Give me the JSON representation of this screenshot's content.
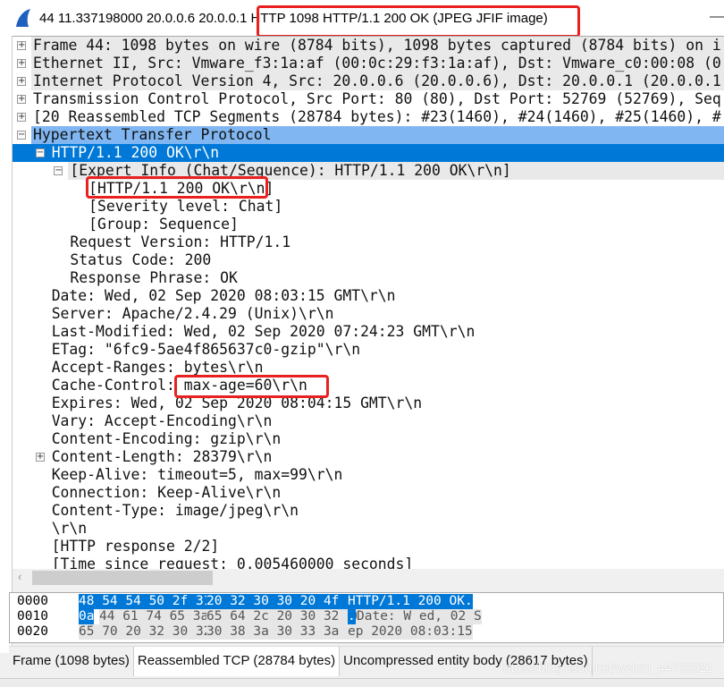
{
  "window": {
    "title_prefix": "44 11.337198000 20.0.0.6 20.0.0.1",
    "title_highlight": "HTTP 1098 HTTP/1.1 200 OK  (JPEG JFIF image)",
    "min_label": "—"
  },
  "tree": [
    {
      "level": 0,
      "exp": "+",
      "text": "Frame 44: 1098 bytes on wire (8784 bits), 1098 bytes captured (8784 bits) on i",
      "style": "g"
    },
    {
      "level": 0,
      "exp": "+",
      "text": "Ethernet II, Src: Vmware_f3:1a:af (00:0c:29:f3:1a:af), Dst: Vmware_c0:00:08 (0",
      "style": "g"
    },
    {
      "level": 0,
      "exp": "+",
      "text": "Internet Protocol Version 4, Src: 20.0.0.6 (20.0.0.6), Dst: 20.0.0.1 (20.0.0.1",
      "style": "g"
    },
    {
      "level": 0,
      "exp": "+",
      "text": "Transmission Control Protocol, Src Port: 80 (80), Dst Port: 52769 (52769), Seq",
      "style": ""
    },
    {
      "level": 0,
      "exp": "+",
      "text": "[20 Reassembled TCP Segments (28784 bytes): #23(1460), #24(1460), #25(1460), #",
      "style": ""
    },
    {
      "level": 0,
      "exp": "−",
      "text": "Hypertext Transfer Protocol",
      "style": "lb"
    },
    {
      "level": 1,
      "exp": "−",
      "text": "HTTP/1.1 200 OK\\r\\n",
      "style": "sel"
    },
    {
      "level": 2,
      "exp": "−",
      "text": "[Expert Info (Chat/Sequence): HTTP/1.1 200 OK\\r\\n]",
      "style": "g"
    },
    {
      "level": 3,
      "exp": "",
      "text": "[HTTP/1.1 200 OK\\r\\n]",
      "style": ""
    },
    {
      "level": 3,
      "exp": "",
      "text": "[Severity level: Chat]",
      "style": ""
    },
    {
      "level": 3,
      "exp": "",
      "text": "[Group: Sequence]",
      "style": ""
    },
    {
      "level": 2,
      "exp": "",
      "text": "Request Version: HTTP/1.1",
      "style": ""
    },
    {
      "level": 2,
      "exp": "",
      "text": "Status Code: 200",
      "style": ""
    },
    {
      "level": 2,
      "exp": "",
      "text": "Response Phrase: OK",
      "style": ""
    },
    {
      "level": 1,
      "exp": "",
      "text": "Date: Wed, 02 Sep 2020 08:03:15 GMT\\r\\n",
      "style": ""
    },
    {
      "level": 1,
      "exp": "",
      "text": "Server: Apache/2.4.29 (Unix)\\r\\n",
      "style": ""
    },
    {
      "level": 1,
      "exp": "",
      "text": "Last-Modified: Wed, 02 Sep 2020 07:24:23 GMT\\r\\n",
      "style": ""
    },
    {
      "level": 1,
      "exp": "",
      "text": "ETag: \"6fc9-5ae4f865637c0-gzip\"\\r\\n",
      "style": ""
    },
    {
      "level": 1,
      "exp": "",
      "text": "Accept-Ranges: bytes\\r\\n",
      "style": ""
    },
    {
      "level": 1,
      "exp": "",
      "text": "Cache-Control: max-age=60\\r\\n",
      "style": ""
    },
    {
      "level": 1,
      "exp": "",
      "text": "Expires: Wed, 02 Sep 2020 08:04:15 GMT\\r\\n",
      "style": ""
    },
    {
      "level": 1,
      "exp": "",
      "text": "Vary: Accept-Encoding\\r\\n",
      "style": ""
    },
    {
      "level": 1,
      "exp": "",
      "text": "Content-Encoding: gzip\\r\\n",
      "style": ""
    },
    {
      "level": 1,
      "exp": "+",
      "text": "Content-Length: 28379\\r\\n",
      "style": ""
    },
    {
      "level": 1,
      "exp": "",
      "text": "Keep-Alive: timeout=5, max=99\\r\\n",
      "style": ""
    },
    {
      "level": 1,
      "exp": "",
      "text": "Connection: Keep-Alive\\r\\n",
      "style": ""
    },
    {
      "level": 1,
      "exp": "",
      "text": "Content-Type: image/jpeg\\r\\n",
      "style": ""
    },
    {
      "level": 1,
      "exp": "",
      "text": "\\r\\n",
      "style": ""
    },
    {
      "level": 1,
      "exp": "",
      "text": "[HTTP response 2/2]",
      "style": ""
    },
    {
      "level": 1,
      "exp": "",
      "text": "[Time since request: 0.005460000 seconds]",
      "style": ""
    }
  ],
  "hex": [
    {
      "offset": "0000",
      "b1": "48 54 54 50 2f 31 2e 31",
      "b2": "20 32 30 30 20 4f 4b 0d",
      "ascii": "HTTP/1.1  200 OK.",
      "sel": "all"
    },
    {
      "offset": "0010",
      "b1first": "0a",
      "b1": "44 61 74 65 3a 20 57",
      "b2": "65 64 2c 20 30 32 20 53",
      "asciifirst": ".",
      "ascii": "Date: W ed, 02 S",
      "sel": "first"
    },
    {
      "offset": "0020",
      "b1": "65 70 20 32 30 32 30 20",
      "b2": "30 38 3a 30 33 3a 31 35",
      "ascii": "ep 2020  08:03:15",
      "sel": "none"
    }
  ],
  "tabs": [
    {
      "label": "Frame (1098 bytes)",
      "active": false
    },
    {
      "label": "Reassembled TCP (28784 bytes)",
      "active": true
    },
    {
      "label": "Uncompressed entity body (28617 bytes)",
      "active": false
    }
  ],
  "watermark": "https://blog.csdn.net/weixin_44733021",
  "colors": {
    "selection": "#0078d7",
    "highlight": "#80b7f2",
    "annotation": "#e82020"
  }
}
